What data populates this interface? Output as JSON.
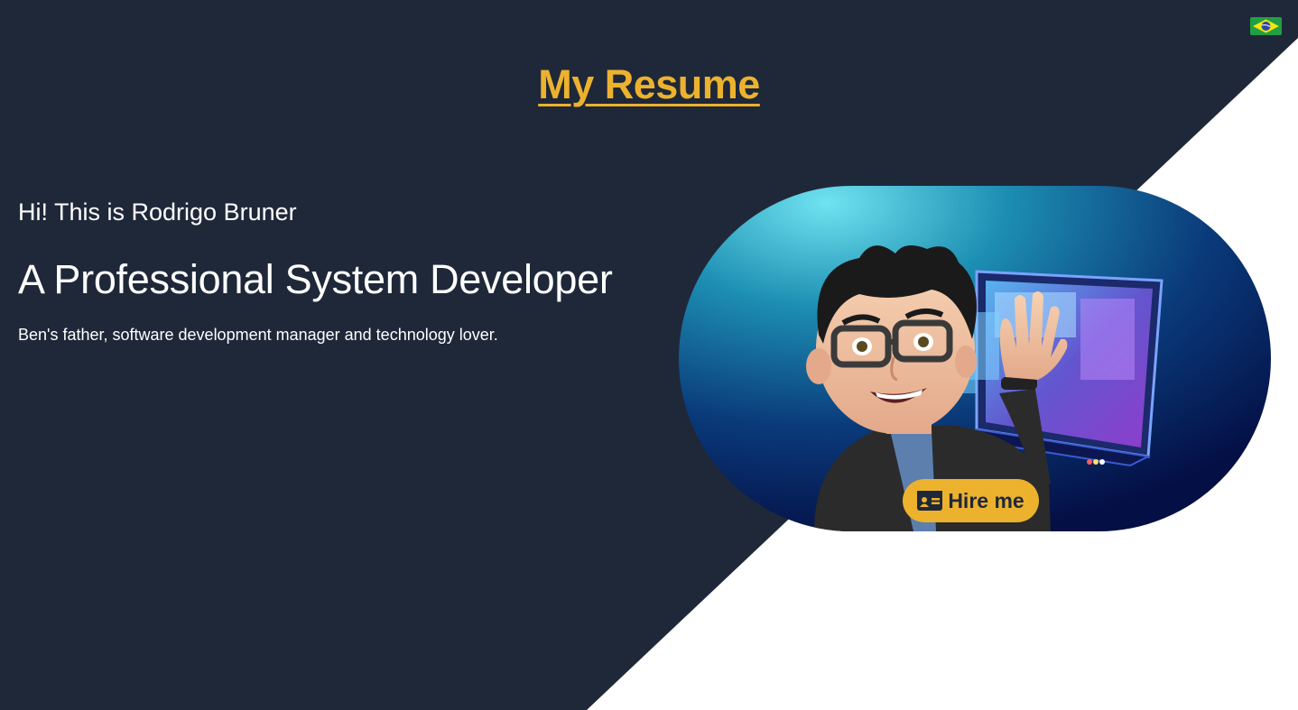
{
  "header": {
    "title": "My Resume",
    "language_flag_icon": "brazil-flag-icon"
  },
  "intro": {
    "greeting": "Hi! This is Rodrigo Bruner",
    "headline": "A Professional System Developer",
    "bio": "Ben's father, software development manager and technology lover."
  },
  "hero": {
    "image": "memoji-avatar-waving-with-laptop",
    "hire_button": {
      "label": "Hire me",
      "icon": "id-card-icon"
    }
  },
  "colors": {
    "background_dark": "#1f2839",
    "background_light": "#ffffff",
    "accent": "#ecb22e",
    "text": "#ffffff"
  }
}
